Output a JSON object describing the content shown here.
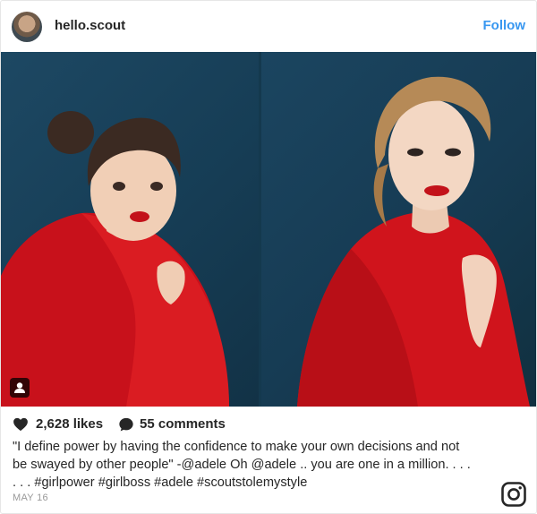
{
  "header": {
    "username": "hello.scout",
    "follow_label": "Follow"
  },
  "photos": {
    "left_icon": "person-icon",
    "colors": {
      "backdrop": "#14394e",
      "coat": "#d0141c",
      "lips": "#c3121a"
    }
  },
  "actions": {
    "heart_icon": "heart-icon",
    "likes": "2,628 likes",
    "comment_icon": "comment-bubble-icon",
    "comments": "55 comments"
  },
  "caption": {
    "line1": "\"I define power by having the confidence to make your own decisions and not",
    "line2": "be swayed by other people\" -@adele Oh @adele .. you are one in a million. . . .",
    "line3": ". . . #girlpower #girlboss #adele #scoutstolemystyle"
  },
  "date": "MAY 16",
  "footer": {
    "logo_icon": "instagram-icon"
  },
  "colors": {
    "link": "#3897f0",
    "text": "#262626",
    "muted": "#999999"
  }
}
